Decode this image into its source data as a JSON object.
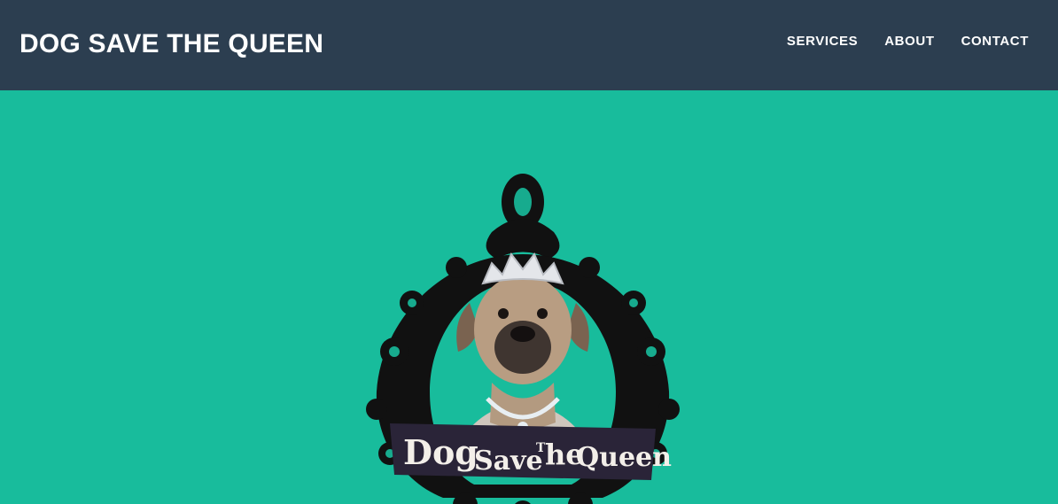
{
  "navbar": {
    "brand": "DOG SAVE THE QUEEN",
    "links": [
      "SERVICES",
      "ABOUT",
      "CONTACT"
    ]
  },
  "hero": {
    "logo_text": [
      "Dog",
      "Save",
      "T",
      "he",
      "Queen"
    ]
  },
  "colors": {
    "navbar_bg": "#2c3e50",
    "hero_bg": "#18bc9c",
    "frame": "#111111",
    "banner": "#2a2438",
    "banner_text": "#f3efe9"
  },
  "icons": {
    "logo": "dog-queen-frame-icon"
  }
}
